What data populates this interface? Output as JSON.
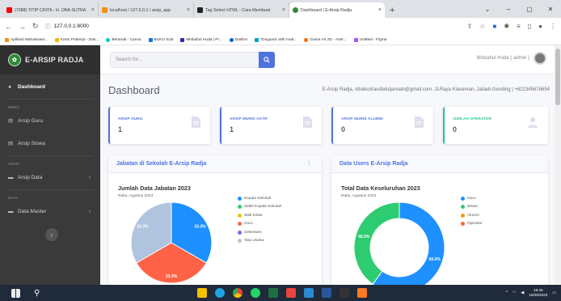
{
  "browser": {
    "tabs": [
      {
        "title": "(7088) TITIP CINTA - H. ONA SUTRA",
        "fav_color": "#ff0000",
        "active": false
      },
      {
        "title": "localhost / 127.0.0.1 / arsip_app",
        "fav_color": "#f29111",
        "active": false
      },
      {
        "title": "Tag Select HTML - Cara Membuat",
        "fav_color": "#222222",
        "active": false
      },
      {
        "title": "Dashboard | E-Arsip Radja",
        "fav_color": "#2f8a35",
        "active": true
      }
    ],
    "new_tab": "+",
    "url": "127.0.0.1:8000",
    "bookmarks": [
      {
        "label": "Aplikasi Mahasiswa...",
        "color": "#f29111"
      },
      {
        "label": "Kartu Prakerja - Das...",
        "color": "#f2b705"
      },
      {
        "label": "Beranda - Canva",
        "color": "#00c4cc"
      },
      {
        "label": "BUKU SLB",
        "color": "#1a73e8"
      },
      {
        "label": "Misbahul Huda | Pr...",
        "color": "#4b1fa8"
      },
      {
        "label": "Dasbor",
        "color": "#0a66c2"
      },
      {
        "label": "*Doypack with matt...",
        "color": "#00a0e0"
      },
      {
        "label": "Game Art 2D - Aset...",
        "color": "#ff6d00"
      },
      {
        "label": "Untitled - Figma",
        "color": "#a259ff"
      }
    ]
  },
  "app": {
    "brand": "E-ARSIP RADJA",
    "search_placeholder": "Search for...",
    "user_label": "Misbahul Huda ( admin )",
    "sidebar": {
      "dashboard": "Dashboard",
      "section_menu": "MENU",
      "arsip_guru": "Arsip Guru",
      "arsip_siswa": "Arsip Siswa",
      "section_arsip": "ARSIP",
      "arsip_data": "Arsip Data",
      "section_data": "DATA",
      "data_master": "Data Master"
    },
    "page_title": "Dashboard",
    "page_subtitle": "E-Arsip Radja, slbabcdraudlatuljannah@gmail.com, JLRaya Klaseman, Jatiadi-Gending | +622345678654",
    "cards": [
      {
        "label": "ARSIP GURU",
        "value": "1",
        "color": "#4e73df"
      },
      {
        "label": "ARSIP MURID AKTIF",
        "value": "1",
        "color": "#4e73df"
      },
      {
        "label": "ARSIP MURID ALUMNI",
        "value": "0",
        "color": "#4e73df"
      },
      {
        "label": "JUMLAH OPERATOR",
        "value": "0",
        "color": "#1cc88a"
      }
    ],
    "panel_left": {
      "heading": "Jabatan di Sekolah E-Arsip Radja",
      "chart_title": "Jumlah Data Jabatan 2023",
      "chart_subtitle": "Rabu, Agustus 2023"
    },
    "panel_right": {
      "heading": "Data Users E-Arsip Radja",
      "chart_title": "Total Data Keseluruhan 2023",
      "chart_subtitle": "Rabu, Agustus 2023"
    }
  },
  "chart_data": [
    {
      "type": "pie",
      "title": "Jumlah Data Jabatan 2023",
      "subtitle": "Rabu, Agustus 2023",
      "categories": [
        "Kepala Sekolah",
        "Wakil Kepala Sekolah",
        "Wali Kelas",
        "Guru",
        "Sekertaris",
        "Tata Usaha"
      ],
      "values": [
        33.3,
        0,
        0,
        33.3,
        0,
        33.3
      ],
      "colors": [
        "#1e90ff",
        "#2ecc71",
        "#f1c40f",
        "#ff6347",
        "#8a5cf5",
        "#b0c4de"
      ],
      "data_labels": [
        "33.3%",
        "33.3%",
        "33.3%"
      ],
      "legend": "right"
    },
    {
      "type": "pie",
      "title": "Total Data Keseluruhan 2023",
      "subtitle": "Rabu, Agustus 2023",
      "categories": [
        "Guru",
        "Siswa",
        "Alumni",
        "Operator"
      ],
      "values": [
        60.0,
        40.0,
        0,
        0
      ],
      "colors": [
        "#1e90ff",
        "#2ecc71",
        "#f39c12",
        "#ff6347"
      ],
      "data_labels": [
        "60.0%",
        "40.0%"
      ],
      "donut": true,
      "legend": "right"
    }
  ],
  "taskbar": {
    "time": "18:46",
    "date": "16/08/2023"
  }
}
